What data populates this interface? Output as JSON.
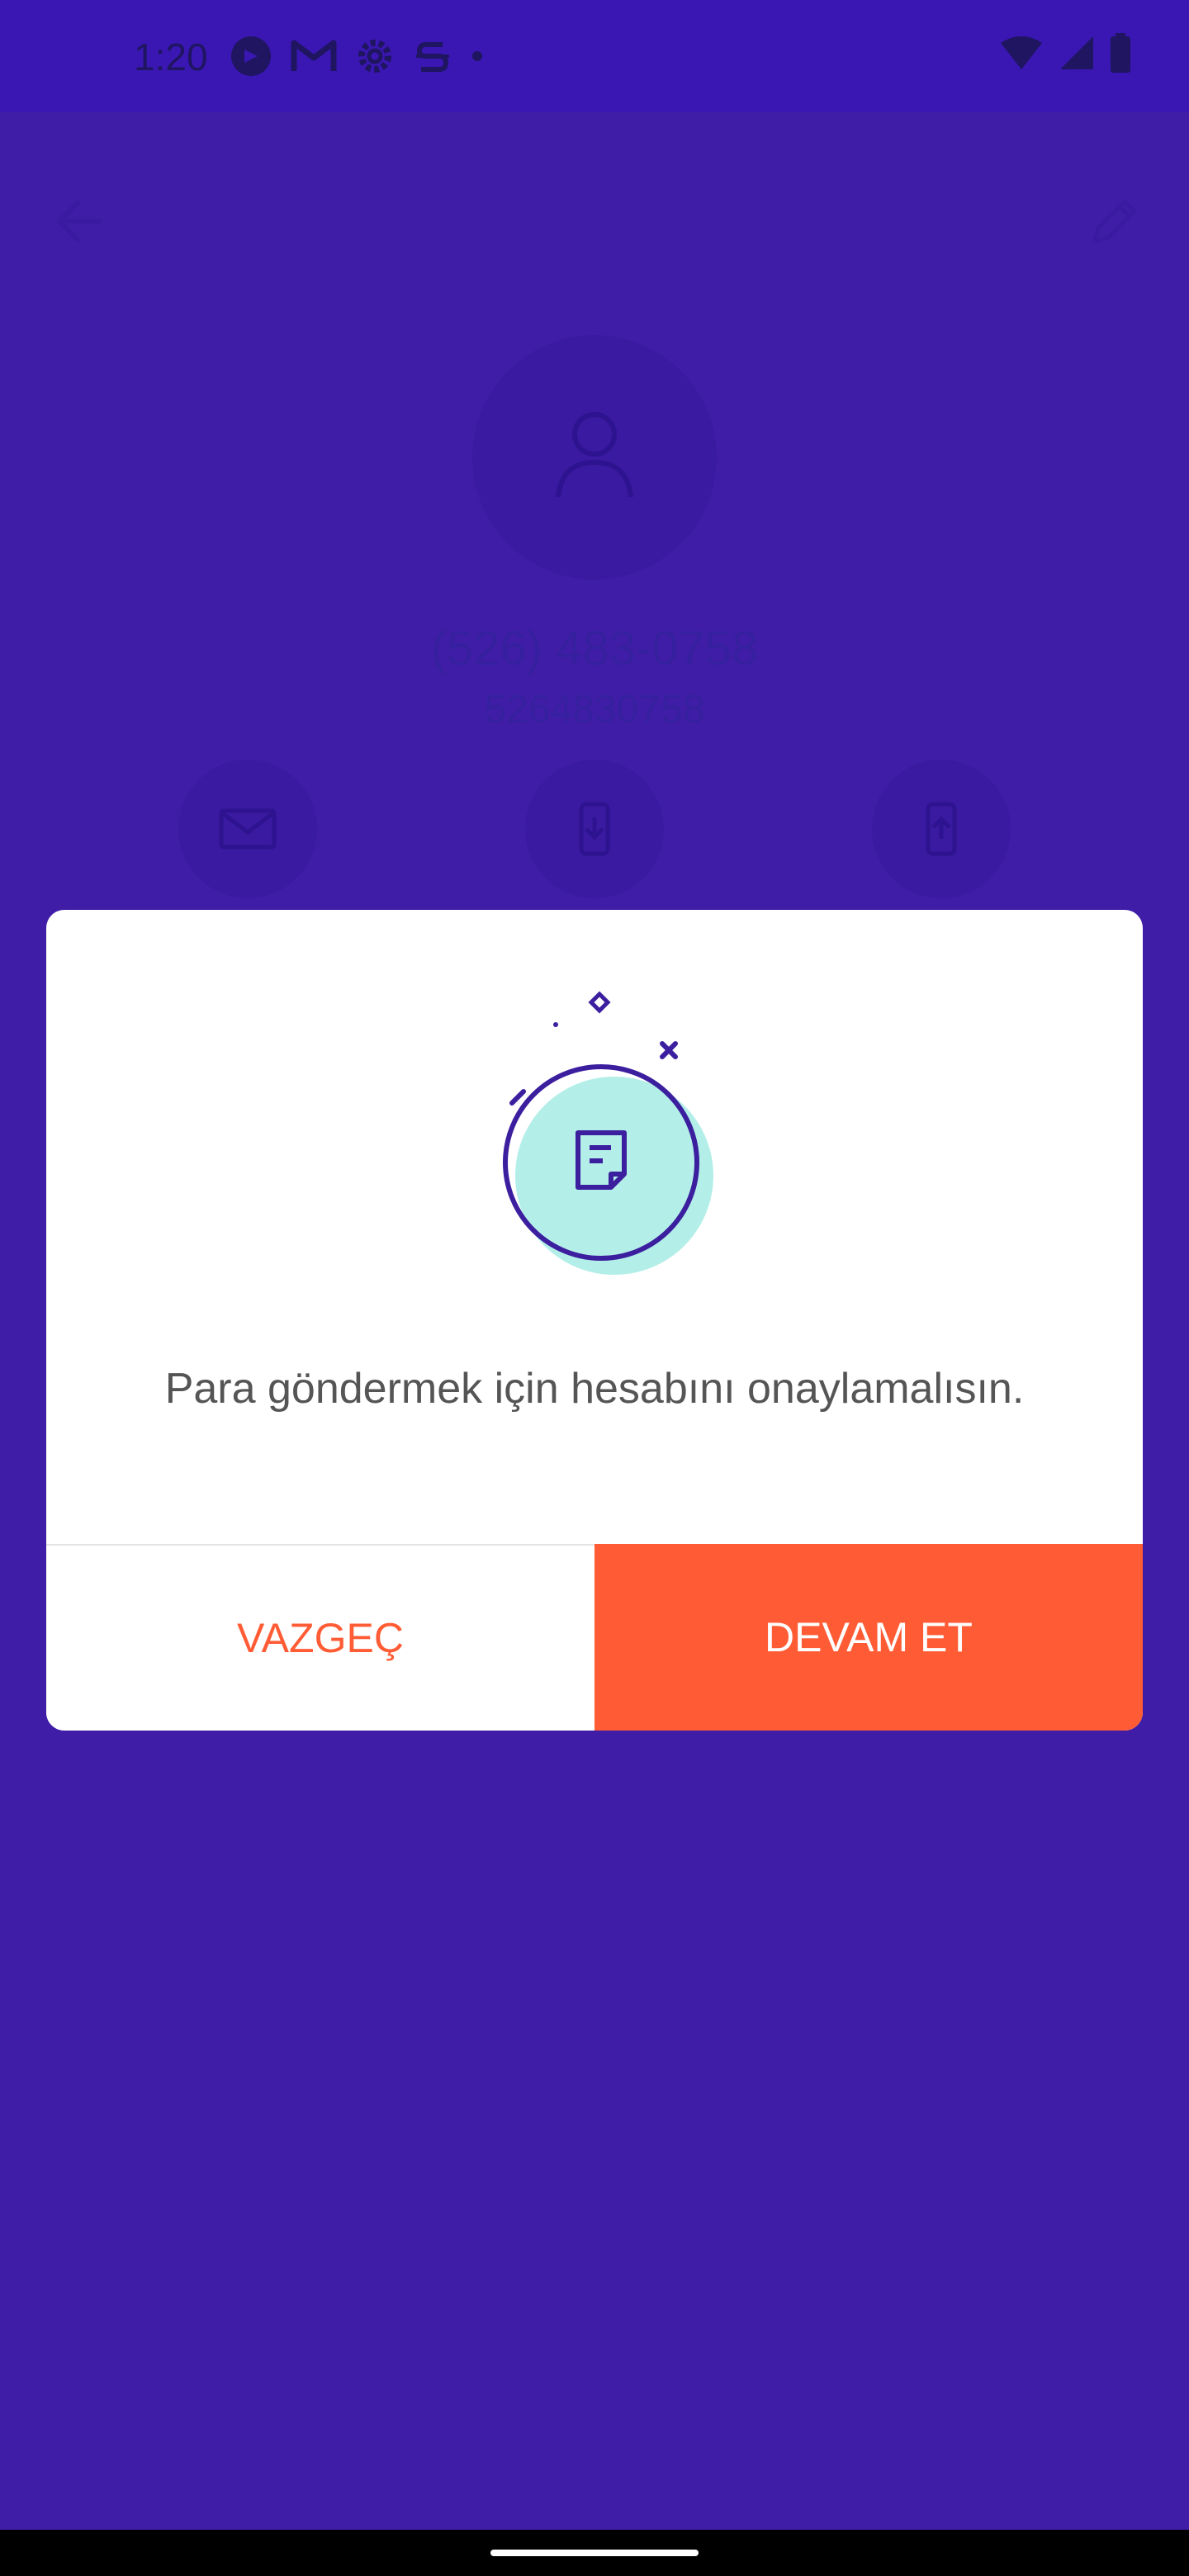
{
  "status_bar": {
    "time": "1:20"
  },
  "contact": {
    "name": "(526) 483-0758",
    "number": "5264830758"
  },
  "dialog": {
    "message": "Para göndermek için hesabını onaylamalısın.",
    "cancel_label": "VAZGEÇ",
    "continue_label": "DEVAM ET"
  },
  "colors": {
    "background": "#401da6",
    "accent": "#ff5c35",
    "illustration_fill": "#b3efe8",
    "illustration_stroke": "#3b1f9f"
  }
}
